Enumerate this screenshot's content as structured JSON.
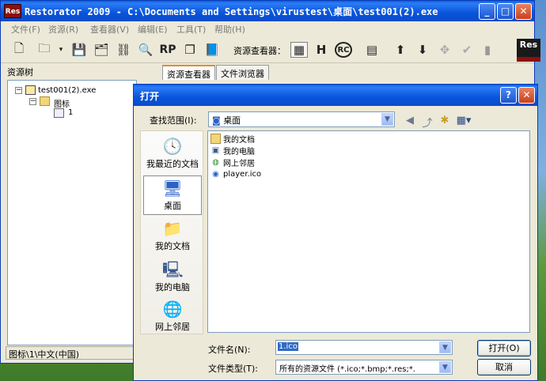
{
  "app": {
    "logo_text": "Res",
    "title": "Restorator 2009 - C:\\Documents and Settings\\virustest\\桌面\\test001(2).exe",
    "min": "_",
    "max": "□",
    "close": "✕"
  },
  "menu": [
    "文件(F)",
    "资源(R)",
    "查看器(V)",
    "编辑(E)",
    "工具(T)",
    "帮助(H)"
  ],
  "toolbar": {
    "viewer_label": "资源查看器：",
    "rp": "RP",
    "rc": "RC",
    "res_logo": "Res"
  },
  "tree": {
    "header": "资源树",
    "root": "test001(2).exe",
    "child": "图标",
    "leaf": "1"
  },
  "tabs": [
    "资源查看器",
    "文件浏览器"
  ],
  "status": "图标\\1\\中文(中国)",
  "dialog": {
    "title": "打开",
    "help": "?",
    "close": "✕",
    "lookin_label": "查找范围(I):",
    "lookin_value": "桌面",
    "places": [
      "我最近的文档",
      "桌面",
      "我的文档",
      "我的电脑",
      "网上邻居"
    ],
    "files": [
      "我的文档",
      "我的电脑",
      "网上邻居",
      "player.ico"
    ],
    "filename_label": "文件名(N):",
    "filename_value": "1.ico",
    "filetype_label": "文件类型(T):",
    "filetype_value": "所有的资源文件  (*.ico;*.bmp;*.res;*.",
    "open_button": "打开(O)",
    "cancel_button": "取消"
  }
}
